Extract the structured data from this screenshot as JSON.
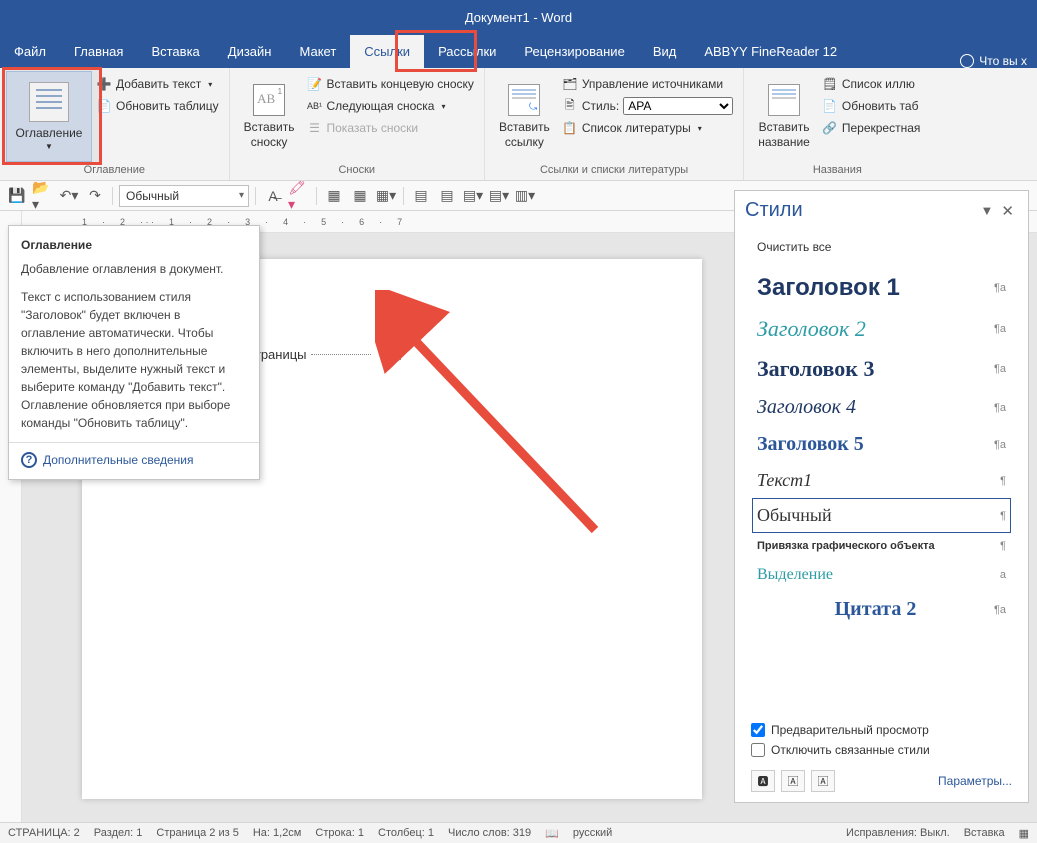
{
  "titlebar": {
    "title": "Документ1 - Word"
  },
  "tabs": {
    "file": "Файл",
    "home": "Главная",
    "insert": "Вставка",
    "design": "Дизайн",
    "layout": "Макет",
    "references": "Ссылки",
    "mailings": "Рассылки",
    "review": "Рецензирование",
    "view": "Вид",
    "abbyy": "ABBYY FineReader 12",
    "tellme": "Что вы х"
  },
  "ribbon": {
    "toc": {
      "button": "Оглавление",
      "add_text": "Добавить текст",
      "update": "Обновить таблицу",
      "group": "Оглавление"
    },
    "footnotes": {
      "insert": "Вставить\nсноску",
      "ab": "AB",
      "sup": "1",
      "endnote": "Вставить концевую сноску",
      "next": "Следующая сноска",
      "show": "Показать сноски",
      "group": "Сноски"
    },
    "citations": {
      "insert": "Вставить\nссылку",
      "manage": "Управление источниками",
      "style_label": "Стиль:",
      "style_value": "APA",
      "biblio": "Список литературы",
      "group": "Ссылки и списки литературы"
    },
    "captions": {
      "insert": "Вставить\nназвание",
      "list": "Список иллю",
      "update": "Обновить таб",
      "cross": "Перекрестная",
      "group": "Названия"
    }
  },
  "qat": {
    "style": "Обычный"
  },
  "ruler": [
    "1",
    "2",
    "1",
    "2",
    "3",
    "4",
    "5",
    "6",
    "7"
  ],
  "page": {
    "break": "Разрыв страницы"
  },
  "tooltip": {
    "title": "Оглавление",
    "p1": "Добавление оглавления в документ.",
    "p2": "Текст с использованием стиля \"Заголовок\" будет включен в оглавление автоматически. Чтобы включить в него дополнительные элементы, выделите нужный текст и выберите команду \"Добавить текст\". Оглавление обновляется при выборе команды \"Обновить таблицу\".",
    "more": "Дополнительные сведения"
  },
  "styles_pane": {
    "title": "Стили",
    "clear": "Очистить все",
    "items": [
      {
        "name": "Заголовок 1",
        "mark": "¶a",
        "cls": "h1"
      },
      {
        "name": "Заголовок 2",
        "mark": "¶a",
        "cls": "h2"
      },
      {
        "name": "Заголовок 3",
        "mark": "¶a",
        "cls": "h3"
      },
      {
        "name": "Заголовок 4",
        "mark": "¶a",
        "cls": "h4"
      },
      {
        "name": "Заголовок 5",
        "mark": "¶a",
        "cls": "h5"
      },
      {
        "name": "Текст1",
        "mark": "¶",
        "cls": "txt1"
      },
      {
        "name": "Обычный",
        "mark": "¶",
        "cls": "normal",
        "selected": true
      },
      {
        "name": "Привязка графического объекта",
        "mark": "¶",
        "cls": "anchor"
      },
      {
        "name": "Выделение",
        "mark": "a",
        "cls": "emphasis"
      },
      {
        "name": "Цитата 2",
        "mark": "¶a",
        "cls": "quote2"
      }
    ],
    "preview": "Предварительный просмотр",
    "disable": "Отключить связанные стили",
    "options": "Параметры..."
  },
  "statusbar": {
    "page": "СТРАНИЦА: 2",
    "section": "Раздел: 1",
    "page_of": "Страница 2 из 5",
    "at": "На: 1,2см",
    "row": "Строка: 1",
    "col": "Столбец: 1",
    "words": "Число слов: 319",
    "lang": "русский",
    "track": "Исправления: Выкл.",
    "insert": "Вставка"
  }
}
